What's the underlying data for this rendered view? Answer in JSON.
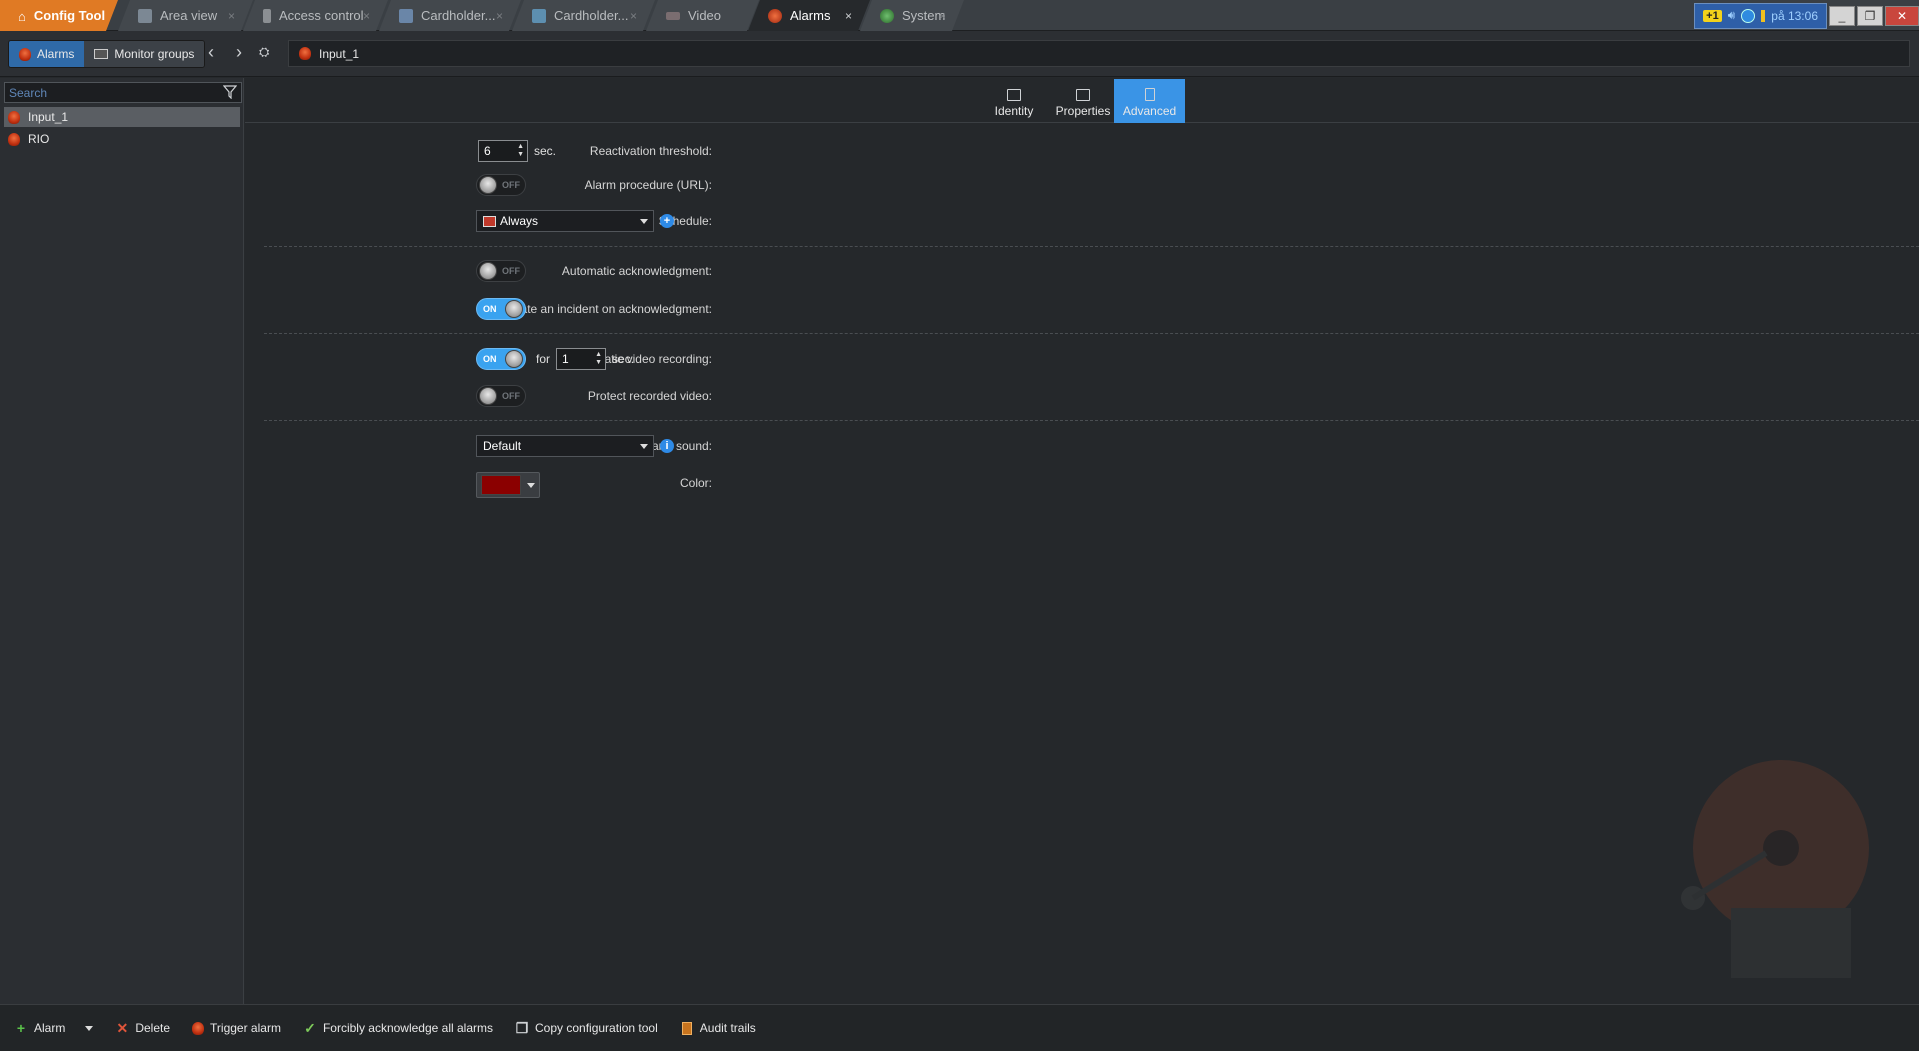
{
  "tabs": [
    {
      "label": "Config Tool",
      "icon": "home-icon"
    },
    {
      "label": "Area view",
      "icon": "area-view-icon"
    },
    {
      "label": "Access control",
      "icon": "access-control-icon"
    },
    {
      "label": "Cardholder...",
      "icon": "cardholder-icon"
    },
    {
      "label": "Cardholder...",
      "icon": "cardholder-icon"
    },
    {
      "label": "Video",
      "icon": "video-icon"
    },
    {
      "label": "Alarms",
      "icon": "alarm-icon"
    },
    {
      "label": "System",
      "icon": "system-icon"
    }
  ],
  "tray": {
    "time": "på 13:06",
    "notification_count": "1"
  },
  "toolbar": {
    "alarms_label": "Alarms",
    "monitor_groups_label": "Monitor groups",
    "breadcrumb": "Input_1"
  },
  "sidebar": {
    "search_placeholder": "Search",
    "items": [
      {
        "label": "Input_1",
        "selected": true
      },
      {
        "label": "RIO",
        "selected": false
      }
    ]
  },
  "view_tabs": [
    {
      "label": "Identity"
    },
    {
      "label": "Properties"
    },
    {
      "label": "Advanced",
      "active": true
    }
  ],
  "settings": {
    "reactivation_label": "Reactivation threshold:",
    "reactivation_value": "6",
    "sec_label": "sec.",
    "procedure_label": "Alarm procedure (URL):",
    "schedule_label": "Schedule:",
    "schedule_value": "Always",
    "auto_ack_label": "Automatic acknowledgment:",
    "incident_label": "Create an incident on acknowledgment:",
    "video_rec_label": "Automatic video recording:",
    "for_label": "for",
    "video_rec_value": "1",
    "protect_label": "Protect recorded video:",
    "sound_label": "Alarm sound:",
    "sound_value": "Default",
    "color_label": "Color:",
    "color_value": "#8b0000",
    "on_text": "ON",
    "off_text": "OFF",
    "toggles": {
      "procedure": "OFF",
      "auto_ack": "OFF",
      "incident": "ON",
      "video_rec": "ON",
      "protect": "OFF"
    }
  },
  "bottombar": {
    "alarm": "Alarm",
    "delete": "Delete",
    "trigger": "Trigger alarm",
    "force_ack": "Forcibly acknowledge all alarms",
    "copy": "Copy configuration tool",
    "audit": "Audit trails"
  },
  "colors": {
    "accent": "#3a94e6",
    "home_tab": "#e07a24",
    "alarm_color": "#8b0000"
  }
}
